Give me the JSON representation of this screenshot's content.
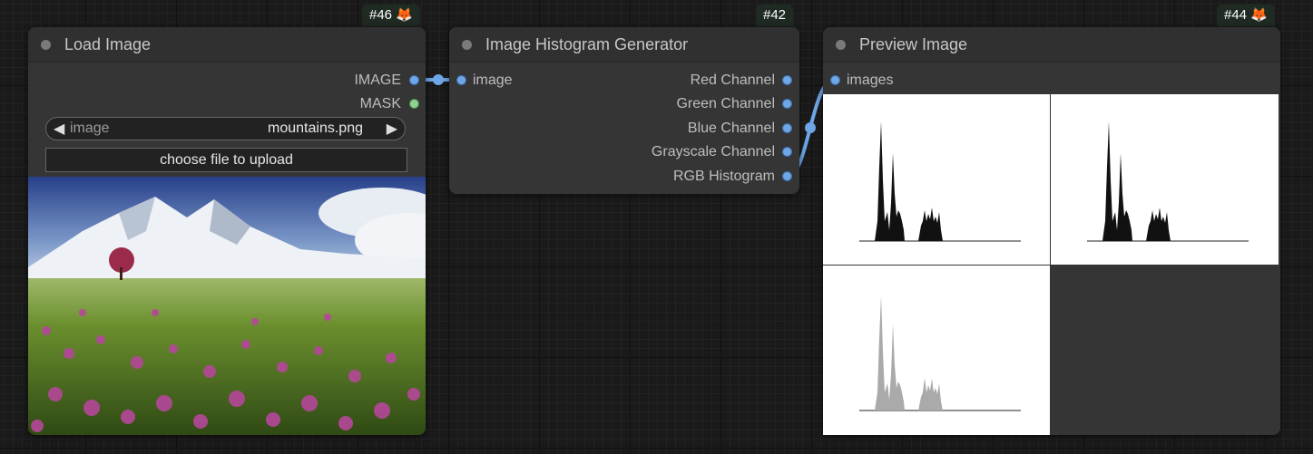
{
  "nodes": {
    "load_image": {
      "badge": "#46",
      "title": "Load Image",
      "outputs": [
        "IMAGE",
        "MASK"
      ],
      "widget_name": "image",
      "widget_value": "mountains.png",
      "upload_label": "choose file to upload"
    },
    "histogram": {
      "badge": "#42",
      "title": "Image Histogram Generator",
      "input": "image",
      "outputs": [
        "Red Channel",
        "Green Channel",
        "Blue Channel",
        "Grayscale Channel",
        "RGB Histogram"
      ]
    },
    "preview": {
      "badge": "#44",
      "title": "Preview Image",
      "input": "images"
    }
  },
  "colors": {
    "image_slot": "#6ea6e8",
    "mask_slot": "#8fd18f",
    "link": "#6ea6e8",
    "canvas": "#1a1a1a",
    "node_body": "#353535"
  },
  "icons": {
    "badge_icon": "fox-icon",
    "combo_prev": "triangle-left-icon",
    "combo_next": "triangle-right-icon"
  }
}
